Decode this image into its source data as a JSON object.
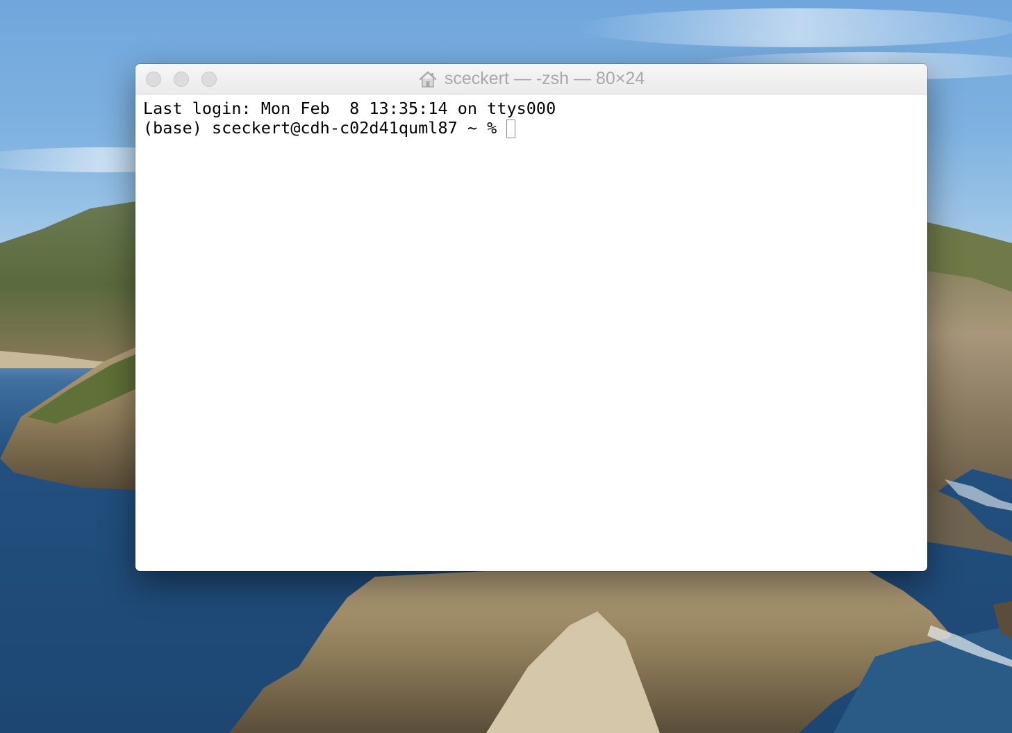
{
  "window": {
    "title": "sceckert — -zsh — 80×24",
    "title_icon": "home-icon",
    "traffic_lights": [
      "close",
      "minimize",
      "zoom"
    ],
    "state": "inactive"
  },
  "terminal": {
    "line1": "Last login: Mon Feb  8 13:35:14 on ttys000",
    "prompt": "(base) sceckert@cdh-c02d41quml87 ~ % ",
    "input": ""
  },
  "colors": {
    "sky": "#7fb2e0",
    "sea": "#22507f",
    "titlebar": "#ebebeb",
    "title_text": "#a8a8a8",
    "terminal_bg": "#ffffff",
    "terminal_text": "#000000"
  }
}
